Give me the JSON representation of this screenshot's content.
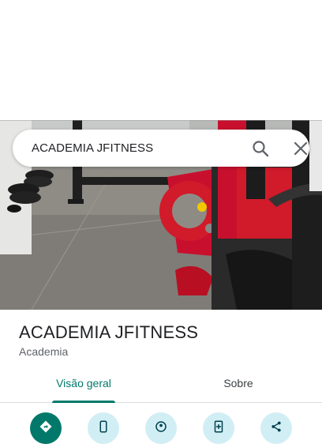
{
  "search": {
    "query": "ACADEMIA JFITNESS"
  },
  "place": {
    "name": "ACADEMIA JFITNESS",
    "category": "Academia"
  },
  "tabs": [
    {
      "label": "Visão geral",
      "selected": true
    },
    {
      "label": "Sobre",
      "selected": false
    }
  ],
  "actions": [
    {
      "icon": "directions-icon"
    },
    {
      "icon": "phone-icon"
    },
    {
      "icon": "street-view-icon"
    },
    {
      "icon": "save-place-icon"
    },
    {
      "icon": "share-icon"
    }
  ],
  "colors": {
    "accent": "#00796b",
    "action_bg": "#d2eef5",
    "text_primary": "#202124",
    "text_secondary": "#5f6368"
  }
}
